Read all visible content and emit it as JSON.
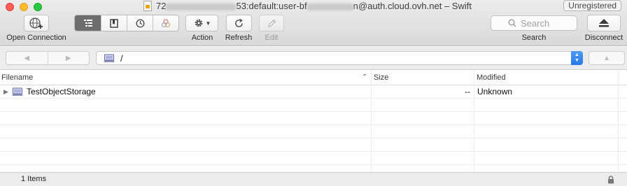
{
  "window": {
    "title_prefix": "72",
    "title_middle": "53:default:user-bf",
    "title_suffix": "n@auth.cloud.ovh.net – Swift",
    "unregistered_label": "Unregistered"
  },
  "toolbar": {
    "open_connection_label": "Open Connection",
    "action_label": "Action",
    "refresh_label": "Refresh",
    "edit_label": "Edit",
    "search_label": "Search",
    "search_placeholder": "Search",
    "disconnect_label": "Disconnect",
    "view_modes": [
      "outline-view-icon",
      "bookmarks-icon",
      "history-icon",
      "bonjour-icon"
    ]
  },
  "navigation": {
    "path_value": "/"
  },
  "table": {
    "columns": {
      "filename": "Filename",
      "size": "Size",
      "modified": "Modified"
    },
    "rows": [
      {
        "name": "TestObjectStorage",
        "size": "--",
        "modified": "Unknown"
      }
    ]
  },
  "status": {
    "items_count": "1 Items"
  },
  "colors": {
    "accent": "#2479e8",
    "selected_segment": "#6d6d6d"
  }
}
